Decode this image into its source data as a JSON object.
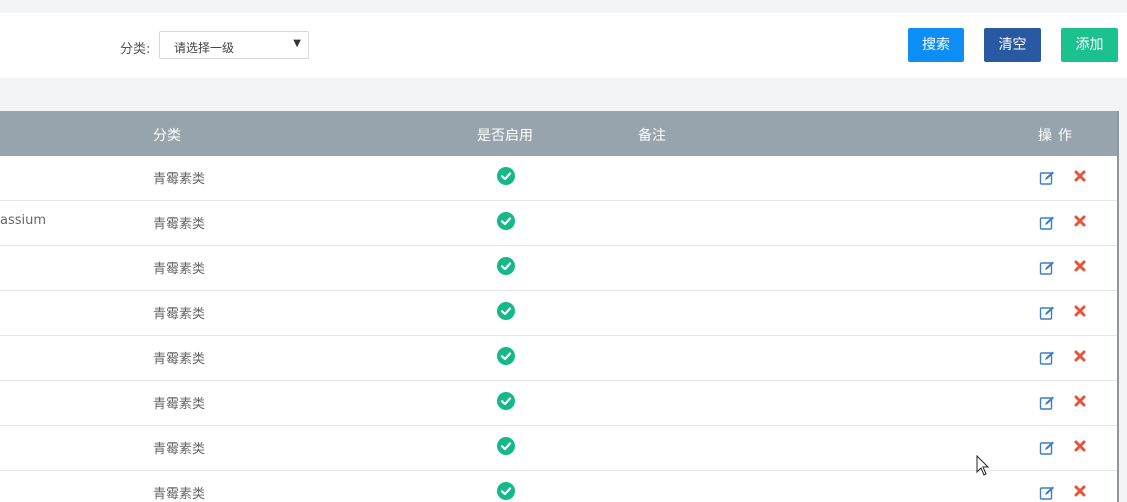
{
  "filter": {
    "category_label": "分类:",
    "select_value": "请选择一级",
    "search_button": "搜索",
    "clear_button": "清空",
    "add_button": "添加"
  },
  "table": {
    "headers": {
      "category": "分类",
      "enabled": "是否启用",
      "remark": "备注",
      "operations": "操作"
    },
    "rows": [
      {
        "name": "",
        "category": "青霉素类",
        "enabled": true,
        "remark": ""
      },
      {
        "name": "assium",
        "category": "青霉素类",
        "enabled": true,
        "remark": ""
      },
      {
        "name": "",
        "category": "青霉素类",
        "enabled": true,
        "remark": ""
      },
      {
        "name": "",
        "category": "青霉素类",
        "enabled": true,
        "remark": ""
      },
      {
        "name": "",
        "category": "青霉素类",
        "enabled": true,
        "remark": ""
      },
      {
        "name": "",
        "category": "青霉素类",
        "enabled": true,
        "remark": ""
      },
      {
        "name": "",
        "category": "青霉素类",
        "enabled": true,
        "remark": ""
      },
      {
        "name": "",
        "category": "青霉素类",
        "enabled": true,
        "remark": ""
      }
    ]
  },
  "colors": {
    "search_button": "#0d8ef5",
    "clear_button": "#2a59a4",
    "add_button": "#1cc28e",
    "header_bg": "#97a4ad",
    "enabled_check": "#14b889",
    "edit_icon": "#3d7fc1",
    "delete_icon": "#e5533b"
  },
  "icons": {
    "enabled": "check-circle-icon",
    "edit": "edit-icon",
    "delete": "delete-x-icon",
    "select_caret": "caret-down-icon"
  }
}
